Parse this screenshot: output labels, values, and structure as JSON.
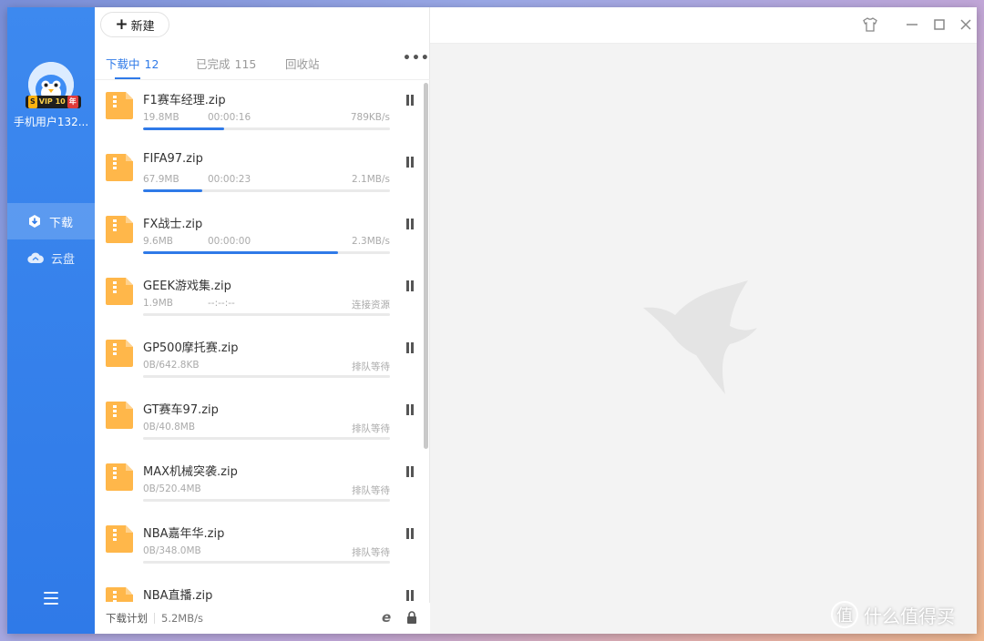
{
  "sidebar": {
    "username": "手机用户132...",
    "vip": {
      "s": "S",
      "label": "VIP 10",
      "year": "年"
    },
    "nav": [
      {
        "label": "下载",
        "active": true,
        "icon": "download-icon"
      },
      {
        "label": "云盘",
        "active": false,
        "icon": "cloud-icon"
      }
    ]
  },
  "toolbar": {
    "new_label": "新建"
  },
  "tabs": [
    {
      "label": "下载中",
      "count": "12",
      "active": true
    },
    {
      "label": "已完成",
      "count": "115",
      "active": false
    },
    {
      "label": "回收站",
      "count": "",
      "active": false
    }
  ],
  "downloads": [
    {
      "name": "F1赛车经理.zip",
      "size": "19.8MB",
      "time": "00:00:16",
      "speed": "789KB/s",
      "progress": 0.33
    },
    {
      "name": "FIFA97.zip",
      "size": "67.9MB",
      "time": "00:00:23",
      "speed": "2.1MB/s",
      "progress": 0.24
    },
    {
      "name": "FX战士.zip",
      "size": "9.6MB",
      "time": "00:00:00",
      "speed": "2.3MB/s",
      "progress": 0.79
    },
    {
      "name": "GEEK游戏集.zip",
      "size": "1.9MB",
      "time": "--:--:--",
      "speed": "连接资源",
      "progress": 0
    },
    {
      "name": "GP500摩托赛.zip",
      "size": "0B/642.8KB",
      "time": "",
      "speed": "排队等待",
      "progress": 0
    },
    {
      "name": "GT赛车97.zip",
      "size": "0B/40.8MB",
      "time": "",
      "speed": "排队等待",
      "progress": 0
    },
    {
      "name": "MAX机械突袭.zip",
      "size": "0B/520.4MB",
      "time": "",
      "speed": "排队等待",
      "progress": 0
    },
    {
      "name": "NBA嘉年华.zip",
      "size": "0B/348.0MB",
      "time": "",
      "speed": "排队等待",
      "progress": 0
    },
    {
      "name": "NBA直播.zip",
      "size": "",
      "time": "",
      "speed": "",
      "progress": 0
    }
  ],
  "bottom": {
    "plan_label": "下载计划",
    "total_speed": "5.2MB/s"
  },
  "watermark": {
    "circle": "值",
    "text": "什么值得买"
  },
  "colors": {
    "accent": "#2f7ae8",
    "file_icon": "#ffb74a"
  }
}
